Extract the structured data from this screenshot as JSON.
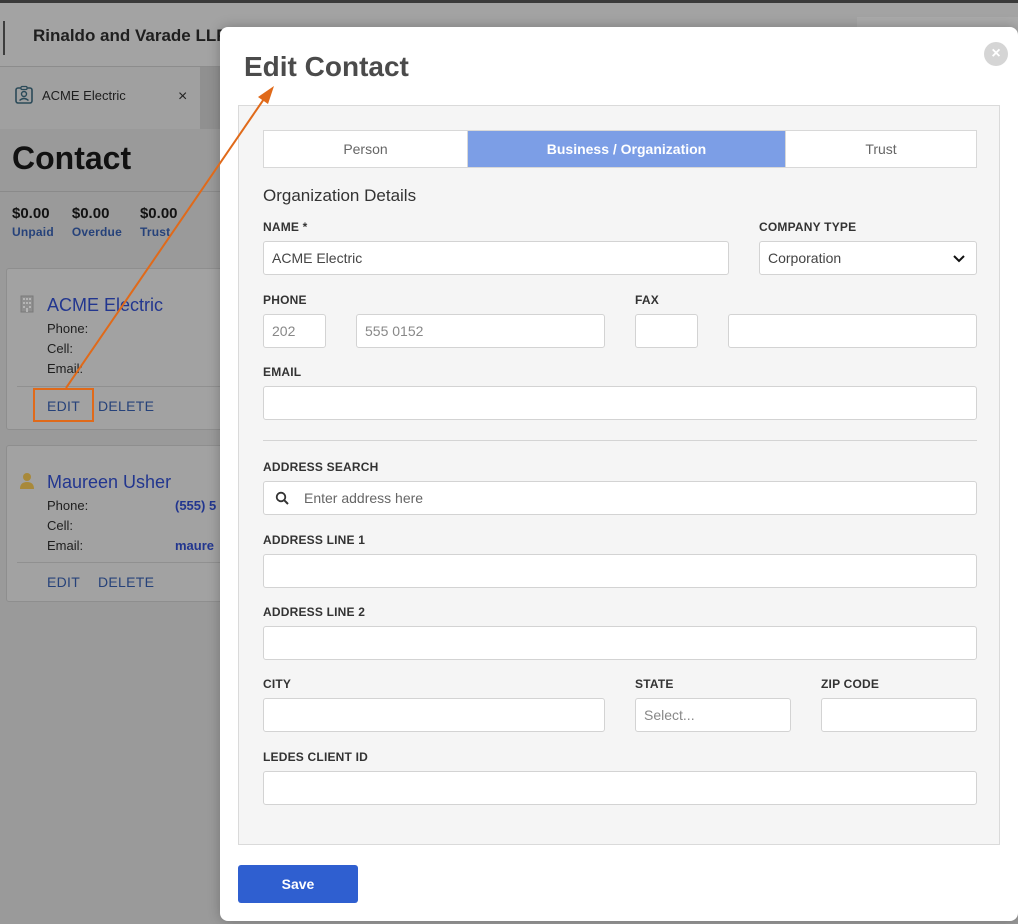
{
  "background": {
    "firm_name": "Rinaldo and Varade LLP",
    "tab": {
      "label": "ACME Electric",
      "close": "×"
    },
    "page_title": "Contact",
    "stats": [
      {
        "amount": "$0.00",
        "label": "Unpaid"
      },
      {
        "amount": "$0.00",
        "label": "Overdue"
      },
      {
        "amount": "$0.00",
        "label": "Trust"
      }
    ],
    "cards": [
      {
        "name": "ACME Electric",
        "phone_label": "Phone:",
        "cell_label": "Cell:",
        "email_label": "Email:",
        "phone_value": "",
        "email_value": "",
        "edit": "EDIT",
        "delete": "DELETE"
      },
      {
        "name": "Maureen Usher",
        "phone_label": "Phone:",
        "cell_label": "Cell:",
        "email_label": "Email:",
        "phone_value": "(555) 5",
        "email_value": "maure",
        "edit": "EDIT",
        "delete": "DELETE"
      }
    ]
  },
  "modal": {
    "title": "Edit Contact",
    "close": "×",
    "tabs": [
      "Person",
      "Business / Organization",
      "Trust"
    ],
    "active_tab": "Business / Organization",
    "section_heading": "Organization Details",
    "fields": {
      "name": {
        "label": "NAME *",
        "value": "ACME Electric"
      },
      "company_type": {
        "label": "COMPANY TYPE",
        "value": "Corporation"
      },
      "phone": {
        "label": "PHONE",
        "area_placeholder": "202",
        "number_placeholder": "555 0152"
      },
      "fax": {
        "label": "FAX",
        "area_value": "",
        "number_value": ""
      },
      "email": {
        "label": "EMAIL",
        "value": ""
      },
      "address_search": {
        "label": "ADDRESS SEARCH",
        "placeholder": "Enter address here"
      },
      "address_line_1": {
        "label": "ADDRESS LINE 1",
        "value": ""
      },
      "address_line_2": {
        "label": "ADDRESS LINE 2",
        "value": ""
      },
      "city": {
        "label": "CITY",
        "value": ""
      },
      "state": {
        "label": "STATE",
        "placeholder": "Select..."
      },
      "zip": {
        "label": "ZIP CODE",
        "value": ""
      },
      "ledes": {
        "label": "LEDES CLIENT ID",
        "value": ""
      }
    },
    "save_label": "Save"
  },
  "colors": {
    "active_tab": "#7c9ee6",
    "save_button": "#2f5fd0",
    "annotation": "#e06a1a",
    "link": "#22368f"
  }
}
